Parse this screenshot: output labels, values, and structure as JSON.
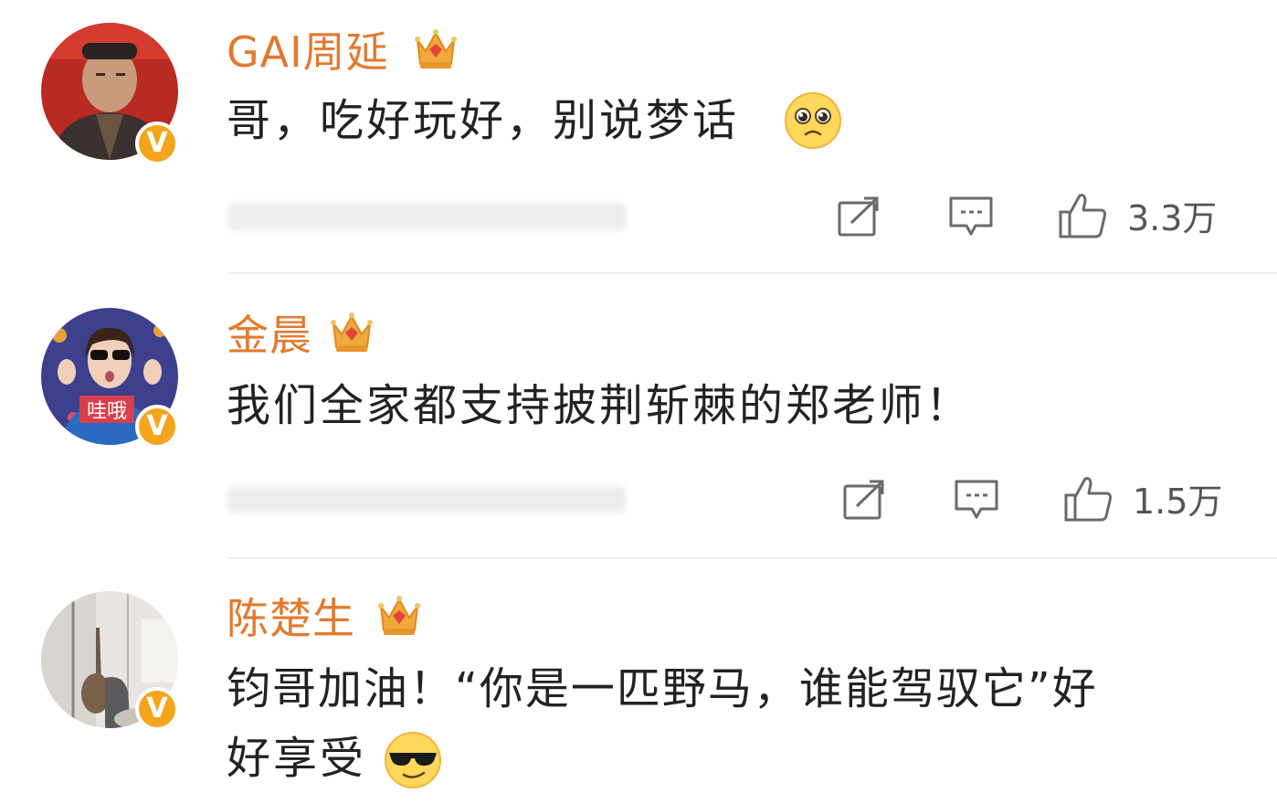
{
  "comments": [
    {
      "username": "GAI周延",
      "text": "哥，吃好玩好，别说梦话",
      "text_line2": "",
      "emoji": "pleading-face-icon",
      "verified": "V",
      "likes": "3.3万"
    },
    {
      "username": "金晨",
      "text": "我们全家都支持披荆斩棘的郑老师！",
      "text_line2": "",
      "emoji": "",
      "verified": "V",
      "avatar_caption": "哇哦",
      "likes": "1.5万"
    },
    {
      "username": "陈楚生",
      "text": "钧哥加油！“你是一匹野马，谁能驾驭它”好",
      "text_line2": "好享受",
      "emoji": "cool-sunglasses-face-icon",
      "verified": "V",
      "likes": ""
    }
  ],
  "colors": {
    "username": "#e27a2e",
    "verified_badge": "#f4a51c",
    "crown": "#f1a93b",
    "text": "#222222"
  },
  "icons": [
    "share-icon",
    "comment-icon",
    "like-icon",
    "crown-icon"
  ]
}
